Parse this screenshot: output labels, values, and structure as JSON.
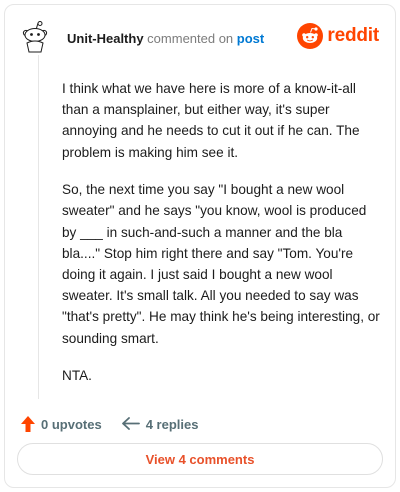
{
  "header": {
    "username": "Unit-Healthy",
    "action_text": " commented on ",
    "post_link": "post",
    "brand_name": "reddit",
    "avatar_icon": "snoo-avatar-icon",
    "brand_icon": "reddit-alien-icon"
  },
  "comment": {
    "paragraphs": [
      "I think what we have here is more of a know-it-all than a mansplainer, but either way, it's super annoying and he needs to cut it out if he can. The problem is making him see it.",
      "So, the next time you say \"I bought a new wool sweater\" and he says \"you know, wool is produced by ___ in such-and-such a manner and the bla bla....\" Stop him right there and say \"Tom. You're doing it again. I just said I bought a new wool sweater. It's small talk. All you needed to say was \"that's pretty\". He may think he's being interesting, or sounding smart.",
      "NTA."
    ]
  },
  "actions": {
    "upvotes_label": "0 upvotes",
    "replies_label": "4 replies",
    "upvote_icon": "upvote-arrow-icon",
    "reply_icon": "reply-arrow-icon"
  },
  "footer": {
    "view_comments_label": "View 4 comments"
  },
  "colors": {
    "brand": "#ff4500",
    "link": "#0079d3",
    "muted": "#576f76",
    "button_text": "#e8512a"
  }
}
